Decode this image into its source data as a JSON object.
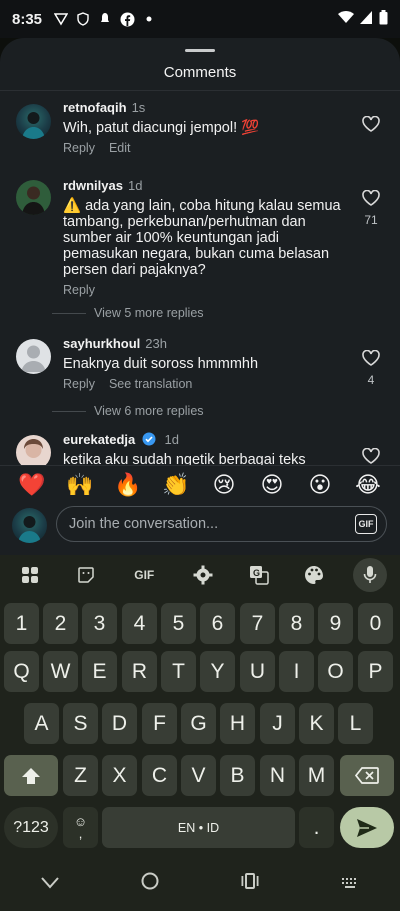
{
  "status": {
    "time": "8:35",
    "icons": [
      "vpn-icon",
      "shield-icon",
      "notification-icon",
      "facebook-icon",
      "dot-icon"
    ],
    "right_icons": [
      "wifi-icon",
      "signal-icon",
      "battery-icon"
    ]
  },
  "sheet": {
    "title": "Comments"
  },
  "comments": [
    {
      "user": "retnofaqih",
      "time": "1s",
      "text": "Wih, patut diacungi jempol! 💯",
      "actions": [
        "Reply",
        "Edit"
      ],
      "likes": ""
    },
    {
      "user": "rdwnilyas",
      "time": "1d",
      "text": "⚠️ ada yang lain, coba hitung kalau semua tambang, perkebunan/perhutman dan sumber air 100% keuntungan jadi pemasukan negara, bukan cuma belasan persen dari pajaknya?",
      "actions": [
        "Reply"
      ],
      "likes": "71",
      "view_more": "View 5 more replies"
    },
    {
      "user": "sayhurkhoul",
      "time": "23h",
      "text": "Enaknya duit soross hmmmhh",
      "actions": [
        "Reply",
        "See translation"
      ],
      "likes": "4",
      "view_more": "View 6 more replies"
    },
    {
      "user": "eurekatedja",
      "time": "1d",
      "text": "ketika aku sudah ngetik berbagai teks",
      "verified": true
    }
  ],
  "reactions": [
    "❤️",
    "🙌",
    "🔥",
    "👏",
    "😢",
    "😍",
    "😮",
    "😂"
  ],
  "composer": {
    "placeholder": "Join the conversation...",
    "gif_label": "GIF"
  },
  "keyboard": {
    "toolbar": [
      "apps-icon",
      "sticker-icon",
      "GIF",
      "settings-icon",
      "translate-icon",
      "palette-icon",
      "mic-icon"
    ],
    "row_numbers": [
      "1",
      "2",
      "3",
      "4",
      "5",
      "6",
      "7",
      "8",
      "9",
      "0"
    ],
    "row_q": [
      "Q",
      "W",
      "E",
      "R",
      "T",
      "Y",
      "U",
      "I",
      "O",
      "P"
    ],
    "row_a": [
      "A",
      "S",
      "D",
      "F",
      "G",
      "H",
      "J",
      "K",
      "L"
    ],
    "row_z": [
      "Z",
      "X",
      "C",
      "V",
      "B",
      "N",
      "M"
    ],
    "sym_label": "?123",
    "emoji_key_top": "☺",
    "emoji_key_bottom": ",",
    "space_label": "EN • ID",
    "period": "."
  },
  "navbar": {
    "icons": [
      "back-chevron-icon",
      "home-circle-icon",
      "recents-icon",
      "keyboard-switch-icon"
    ]
  }
}
